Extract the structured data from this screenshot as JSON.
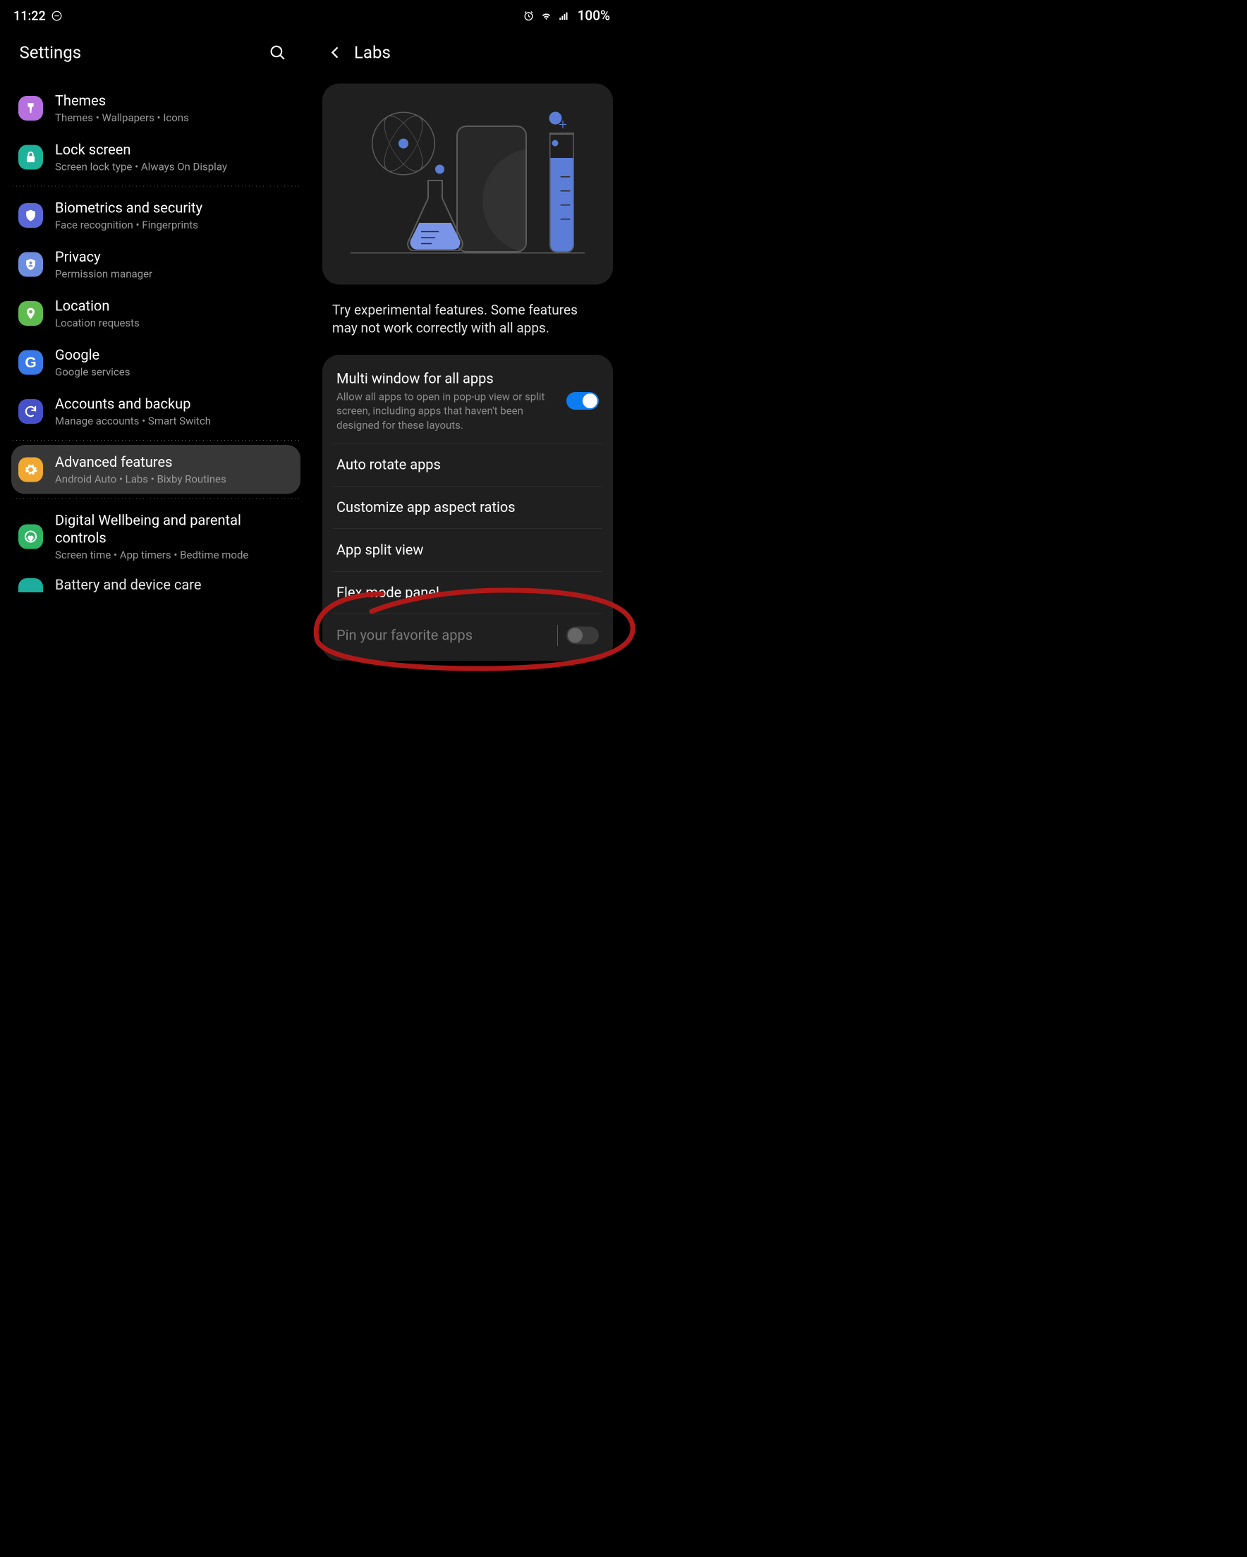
{
  "status": {
    "time": "11:22",
    "battery": "100%"
  },
  "left": {
    "title": "Settings",
    "items": [
      {
        "title": "Themes",
        "sub": "Themes  •  Wallpapers  •  Icons",
        "color": "#b670e0",
        "icon": "themes"
      },
      {
        "title": "Lock screen",
        "sub": "Screen lock type  •  Always On Display",
        "color": "#1fb29b",
        "icon": "lock"
      },
      {
        "title": "Biometrics and security",
        "sub": "Face recognition  •  Fingerprints",
        "color": "#5b68d8",
        "icon": "shield"
      },
      {
        "title": "Privacy",
        "sub": "Permission manager",
        "color": "#6d8ee0",
        "icon": "privacy"
      },
      {
        "title": "Location",
        "sub": "Location requests",
        "color": "#5fbb4d",
        "icon": "pin"
      },
      {
        "title": "Google",
        "sub": "Google services",
        "color": "#3a7ae8",
        "icon": "google"
      },
      {
        "title": "Accounts and backup",
        "sub": "Manage accounts  •  Smart Switch",
        "color": "#4550c9",
        "icon": "sync"
      },
      {
        "title": "Advanced features",
        "sub": "Android Auto  •  Labs  •  Bixby Routines",
        "color": "#f0a830",
        "icon": "gear"
      },
      {
        "title": "Digital Wellbeing and parental controls",
        "sub": "Screen time  •  App timers  •  Bedtime mode",
        "color": "#30b565",
        "icon": "wellbeing"
      },
      {
        "title": "Battery and device care",
        "sub": "",
        "color": "#20c0b0",
        "icon": "care"
      }
    ]
  },
  "right": {
    "title": "Labs",
    "intro": "Try experimental features. Some features may not work correctly with all apps.",
    "settings": [
      {
        "title": "Multi window for all apps",
        "sub": "Allow all apps to open in pop-up view or split screen, including apps that haven't been designed for these layouts.",
        "switch": "on"
      },
      {
        "title": "Auto rotate apps",
        "sub": "",
        "switch": ""
      },
      {
        "title": "Customize app aspect ratios",
        "sub": "",
        "switch": ""
      },
      {
        "title": "App split view",
        "sub": "",
        "switch": ""
      },
      {
        "title": "Flex mode panel",
        "sub": "",
        "switch": ""
      },
      {
        "title": "Pin your favorite apps",
        "sub": "",
        "switch": "off-dim"
      }
    ]
  }
}
